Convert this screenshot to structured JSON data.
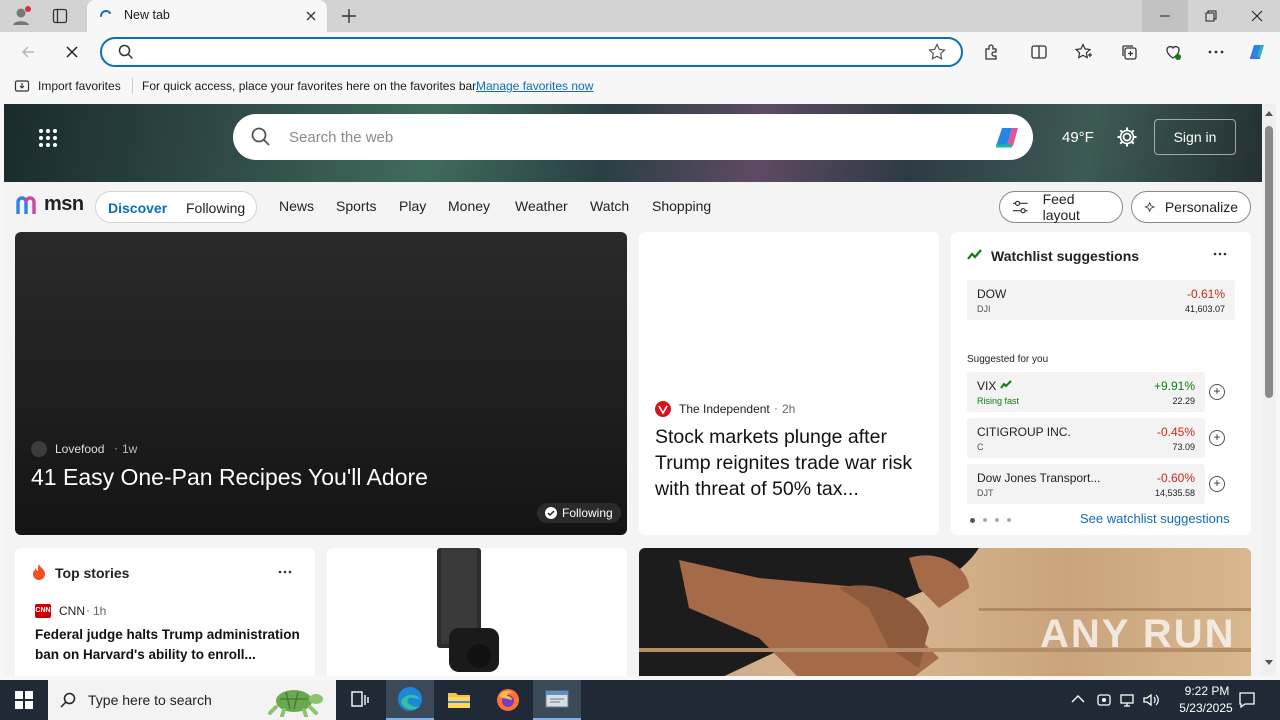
{
  "browser": {
    "tab_title": "New tab",
    "address_value": "",
    "favorites_bar": {
      "import_label": "Import favorites",
      "hint": "For quick access, place your favorites here on the favorites bar.",
      "manage_link": "Manage favorites now"
    }
  },
  "msn": {
    "search_placeholder": "Search the web",
    "temperature": "49°F",
    "sign_in": "Sign in",
    "logo": "msn",
    "nav_pill": [
      "Discover",
      "Following"
    ],
    "nav_links": [
      "News",
      "Sports",
      "Play",
      "Money",
      "Weather",
      "Watch",
      "Shopping"
    ],
    "feed_layout": "Feed layout",
    "personalize": "Personalize",
    "hero_story": {
      "source": "Lovefood",
      "age": "1w",
      "title": "41 Easy One-Pan Recipes You'll Adore",
      "following": "Following"
    },
    "second_story": {
      "source": "The Independent",
      "age": "2h",
      "title": "Stock markets plunge after Trump reignites trade war risk with threat of 50% tax..."
    },
    "watchlist": {
      "title": "Watchlist suggestions",
      "index": {
        "name": "DOW",
        "symbol": "DJI",
        "change": "-0.61%",
        "price": "41,603.07"
      },
      "suggested_label": "Suggested for you",
      "items": [
        {
          "name": "VIX",
          "symbol": "Rising fast",
          "change": "+9.91%",
          "price": "22.29"
        },
        {
          "name": "CITIGROUP INC.",
          "symbol": "C",
          "change": "-0.45%",
          "price": "73.09"
        },
        {
          "name": "Dow Jones Transport...",
          "symbol": "DJT",
          "change": "-0.60%",
          "price": "14,535.58"
        }
      ],
      "see_link": "See watchlist suggestions"
    },
    "top_stories": {
      "title": "Top stories",
      "source": "CNN",
      "age": "1h",
      "headline": "Federal judge halts Trump administration ban on Harvard's ability to enroll..."
    },
    "watermark": "ANY RUN"
  },
  "taskbar": {
    "search_placeholder": "Type here to search",
    "time": "9:22 PM",
    "date": "5/23/2025"
  },
  "colors": {
    "accent": "#0f6cbd",
    "negative": "#c42b1c",
    "positive": "#107c10"
  }
}
